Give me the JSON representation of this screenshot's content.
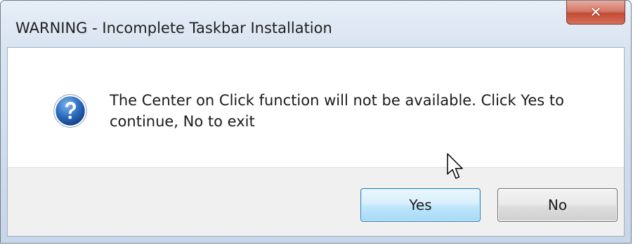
{
  "dialog": {
    "title": "WARNING - Incomplete Taskbar Installation",
    "close_glyph": "✕",
    "icon": "question-icon",
    "message": "The Center on Click function will not be available.  Click Yes to continue, No to exit",
    "buttons": {
      "yes_label": "Yes",
      "no_label": "No"
    }
  },
  "colors": {
    "close_button": "#c24b35",
    "icon_blue": "#1f5aa6",
    "yes_button_border": "#3c7fb1"
  }
}
